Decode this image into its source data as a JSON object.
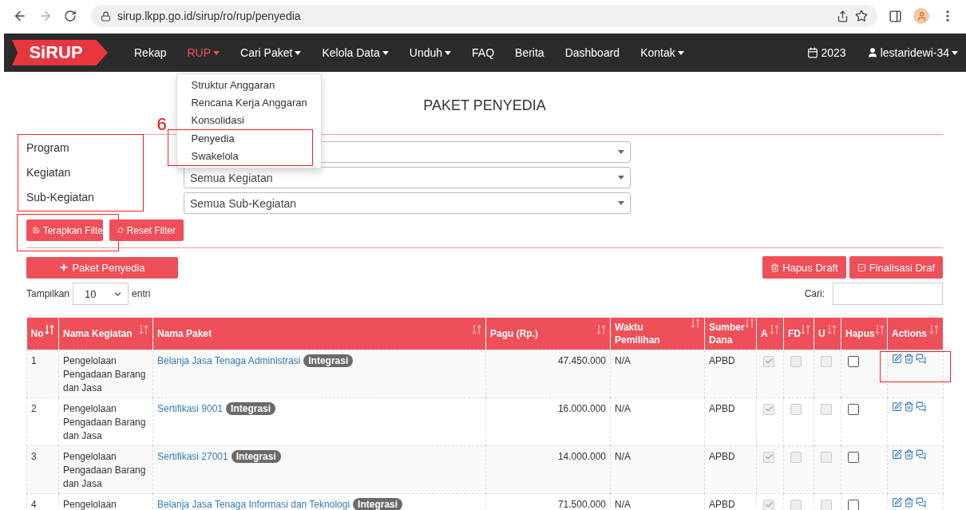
{
  "browser": {
    "url": "sirup.lkpp.go.id/sirup/ro/rup/penyedia"
  },
  "navbar": {
    "logo": "SiRUP",
    "items": [
      {
        "label": "Rekap",
        "selected": false,
        "caret": false
      },
      {
        "label": "RUP",
        "selected": true,
        "caret": true
      },
      {
        "label": "Cari Paket",
        "selected": false,
        "caret": true
      },
      {
        "label": "Kelola Data",
        "selected": false,
        "caret": true
      },
      {
        "label": "Unduh",
        "selected": false,
        "caret": true
      },
      {
        "label": "FAQ",
        "selected": false,
        "caret": false
      },
      {
        "label": "Berita",
        "selected": false,
        "caret": false
      },
      {
        "label": "Dashboard",
        "selected": false,
        "caret": false
      },
      {
        "label": "Kontak",
        "selected": false,
        "caret": true
      }
    ],
    "year": "2023",
    "user": "lestaridewi-34"
  },
  "rup_menu": {
    "annotation": "6",
    "items": [
      {
        "label": "Struktur Anggaran",
        "highlighted": false
      },
      {
        "label": "Rencana Kerja Anggaran",
        "highlighted": false
      },
      {
        "label": "Konsolidasi",
        "highlighted": false
      },
      {
        "label": "Penyedia",
        "highlighted": true
      },
      {
        "label": "Swakelola",
        "highlighted": true
      }
    ]
  },
  "page_title": "PAKET PENYEDIA",
  "filters": {
    "highlighted": true,
    "rows": [
      {
        "label": "Program"
      },
      {
        "label": "Kegiatan",
        "value": "Semua Kegiatan"
      },
      {
        "label": "Sub-Kegiatan",
        "value": "Semua Sub-Kegiatan"
      }
    ]
  },
  "filter_buttons": [
    {
      "label": "Terapkan Filte",
      "kind": "apply",
      "highlighted": true
    },
    {
      "label": "Reset Filter",
      "kind": "reset"
    }
  ],
  "add_button": "Paket Penyedia",
  "draft_buttons": [
    {
      "label": "Hapus Draft",
      "kind": "delete"
    },
    {
      "label": "Finalisasi Draf",
      "kind": "finalize"
    }
  ],
  "length": {
    "prefix": "Tampilkan",
    "value": "10",
    "suffix": "entri"
  },
  "search": {
    "label": "Cari:"
  },
  "table": {
    "columns": [
      {
        "label": "No",
        "sorted": true
      },
      {
        "label": "Nama Kegiatan",
        "sorted": false
      },
      {
        "label": "Nama Paket",
        "sorted": false
      },
      {
        "label": "Pagu (Rp.)",
        "sorted": false
      },
      {
        "label": "Waktu Pemilihan",
        "sorted": false
      },
      {
        "label": "Sumber Dana",
        "sorted": false
      },
      {
        "label": "A",
        "sorted": false
      },
      {
        "label": "FD",
        "sorted": false
      },
      {
        "label": "U",
        "sorted": false
      },
      {
        "label": "Hapus",
        "sorted": false
      },
      {
        "label": "Actions",
        "sorted": false
      }
    ],
    "rows": [
      {
        "no": "1",
        "kegiatan": "Pengelolaan Pengadaan Barang dan Jasa",
        "paket": "Belanja Jasa Tenaga Administrasi",
        "badge": "Integrasi",
        "pagu": "47.450.000",
        "waktu": "N/A",
        "sumber": "APBD",
        "flags": [
          {
            "checked": true,
            "disabled": true
          },
          {
            "checked": false,
            "disabled": true
          },
          {
            "checked": false,
            "disabled": true
          },
          {
            "checked": false,
            "disabled": false
          }
        ],
        "actions_highlighted": true
      },
      {
        "no": "2",
        "kegiatan": "Pengelolaan Pengadaan Barang dan Jasa",
        "paket": "Sertifikasi 9001",
        "badge": "Integrasi",
        "pagu": "16.000.000",
        "waktu": "N/A",
        "sumber": "APBD",
        "flags": [
          {
            "checked": true,
            "disabled": true
          },
          {
            "checked": false,
            "disabled": true
          },
          {
            "checked": false,
            "disabled": true
          },
          {
            "checked": false,
            "disabled": false
          }
        ],
        "actions_highlighted": false
      },
      {
        "no": "3",
        "kegiatan": "Pengelolaan Pengadaan Barang dan Jasa",
        "paket": "Sertifikasi 27001",
        "badge": "Integrasi",
        "pagu": "14.000.000",
        "waktu": "N/A",
        "sumber": "APBD",
        "flags": [
          {
            "checked": true,
            "disabled": true
          },
          {
            "checked": false,
            "disabled": true
          },
          {
            "checked": false,
            "disabled": true
          },
          {
            "checked": false,
            "disabled": false
          }
        ],
        "actions_highlighted": false
      },
      {
        "no": "4",
        "kegiatan": "Pengelolaan",
        "paket": "Belanja Jasa Tenaga Informasi dan Teknologi",
        "badge": "Integrasi",
        "pagu": "71.500.000",
        "waktu": "N/A",
        "sumber": "APBD",
        "flags": [
          {
            "checked": true,
            "disabled": true
          },
          {
            "checked": false,
            "disabled": true
          },
          {
            "checked": false,
            "disabled": true
          },
          {
            "checked": false,
            "disabled": false
          }
        ],
        "actions_highlighted": false
      }
    ]
  }
}
